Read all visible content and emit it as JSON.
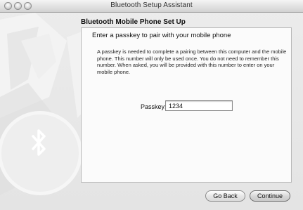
{
  "window": {
    "title": "Bluetooth Setup Assistant"
  },
  "heading": "Bluetooth Mobile Phone Set Up",
  "panel": {
    "subtitle": "Enter a passkey to pair with your mobile phone",
    "description": "A passkey is needed to complete a pairing between this computer and the mobile phone. This number will only be used once. You do not need to remember this number. When asked, you will be provided with this number to enter on your mobile phone.",
    "passkey_label": "Passkey:",
    "passkey_value": "1234"
  },
  "buttons": {
    "back": "Go Back",
    "continue": "Continue"
  },
  "icons": [
    "close-icon",
    "minimize-icon",
    "zoom-icon",
    "bluetooth-icon"
  ]
}
